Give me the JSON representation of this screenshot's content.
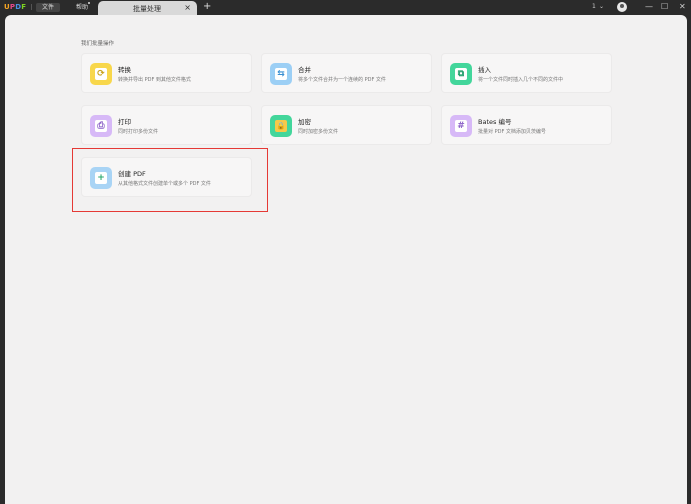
{
  "app": {
    "logo_letters": [
      "U",
      "P",
      "D",
      "F"
    ],
    "logo_colors": [
      "#f5a623",
      "#e5488a",
      "#4a90e2",
      "#7ed321"
    ],
    "menu": {
      "file": "文件",
      "help": "帮助"
    }
  },
  "tab": {
    "label": "批量处理",
    "close": "×",
    "add": "+"
  },
  "window_controls": {
    "count": "1",
    "chevron": "⌄",
    "minimize": "—",
    "maximize": "☐",
    "close": "✕"
  },
  "main": {
    "section_title": "我们批量操作",
    "cards": [
      {
        "title": "转换",
        "desc": "转换并导出 PDF 到其他文件格式",
        "icon": "convert-icon",
        "color": "#f8d74b",
        "glyph": "⟳"
      },
      {
        "title": "合并",
        "desc": "将多个文件合并为一个连续的 PDF 文件",
        "icon": "merge-icon",
        "color": "#9ccff5",
        "glyph": "⇆"
      },
      {
        "title": "插入",
        "desc": "将一个文件同时插入几个不同的文件中",
        "icon": "insert-icon",
        "color": "#43d69b",
        "glyph": "⧉"
      },
      {
        "title": "打印",
        "desc": "同时打印多份文件",
        "icon": "print-icon",
        "color": "#d7b9f7",
        "glyph": "⎙"
      },
      {
        "title": "加密",
        "desc": "同时加密多份文件",
        "icon": "encrypt-icon",
        "color": "#43d69b",
        "glyph": "🔒"
      },
      {
        "title": "Bates 编号",
        "desc": "批量对 PDF 文档添加贝茨编号",
        "icon": "bates-icon",
        "color": "#d7b9f7",
        "glyph": "#"
      },
      {
        "title": "创建 PDF",
        "desc": "从其他格式文件创建单个或多个 PDF 文件",
        "icon": "create-pdf-icon",
        "color": "#a9d4f5",
        "glyph": "+"
      }
    ],
    "highlight_color": "#e53935"
  }
}
